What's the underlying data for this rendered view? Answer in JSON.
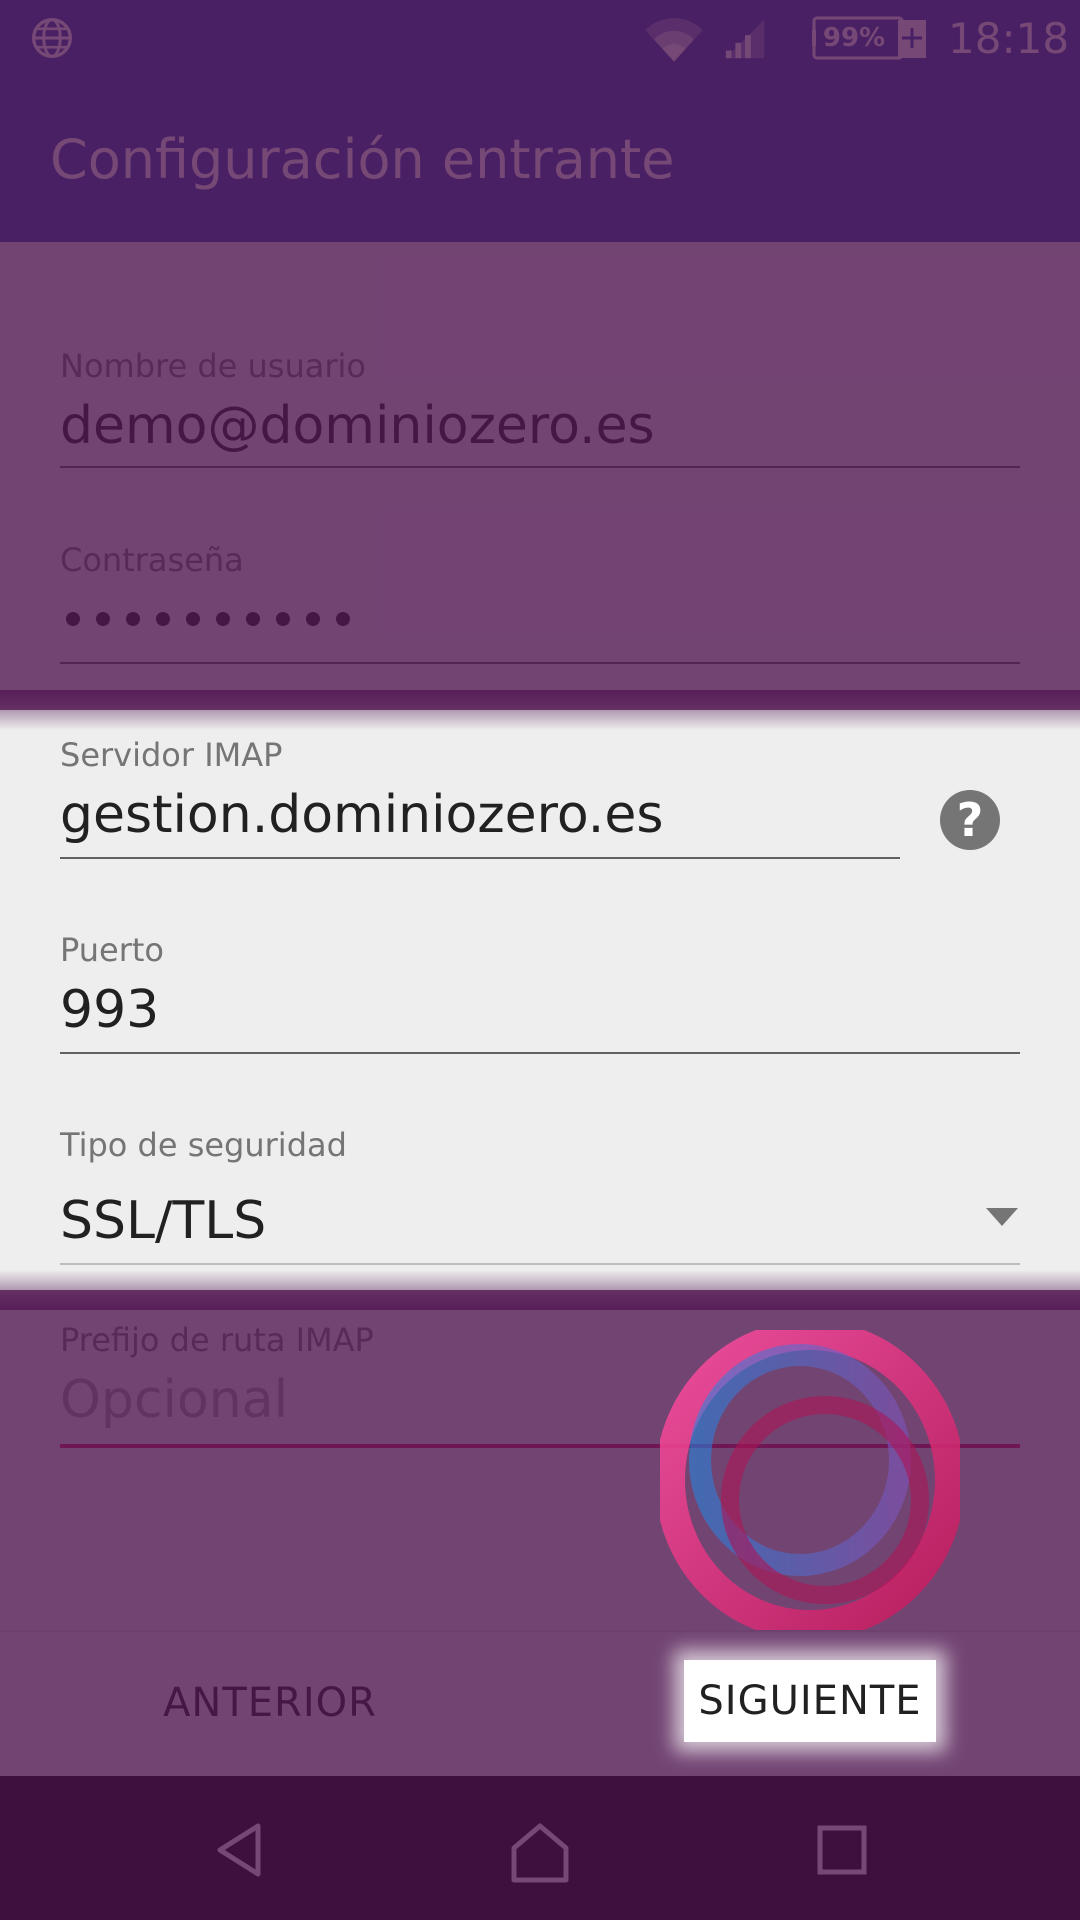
{
  "status_bar": {
    "battery": "99%",
    "time": "18:18",
    "icons": [
      "globe-icon",
      "wifi-icon",
      "signal-icon",
      "battery-icon"
    ]
  },
  "app_bar": {
    "title": "Configuración entrante"
  },
  "form": {
    "username": {
      "label": "Nombre de usuario",
      "value": "demo@dominiozero.es"
    },
    "password": {
      "label": "Contraseña",
      "value": "••••••••••"
    },
    "imap_server": {
      "label": "Servidor IMAP",
      "value": "gestion.dominiozero.es",
      "help_icon": "question-circle-icon"
    },
    "port": {
      "label": "Puerto",
      "value": "993"
    },
    "security_type": {
      "label": "Tipo de seguridad",
      "value": "SSL/TLS"
    },
    "imap_path_prefix": {
      "label": "Prefijo de ruta IMAP",
      "placeholder": "Opcional"
    }
  },
  "buttons": {
    "previous": "ANTERIOR",
    "next": "SIGUIENTE"
  },
  "colors": {
    "app_bar": "#3949ab",
    "overlay": "#501450",
    "accent": "#e91e63"
  }
}
